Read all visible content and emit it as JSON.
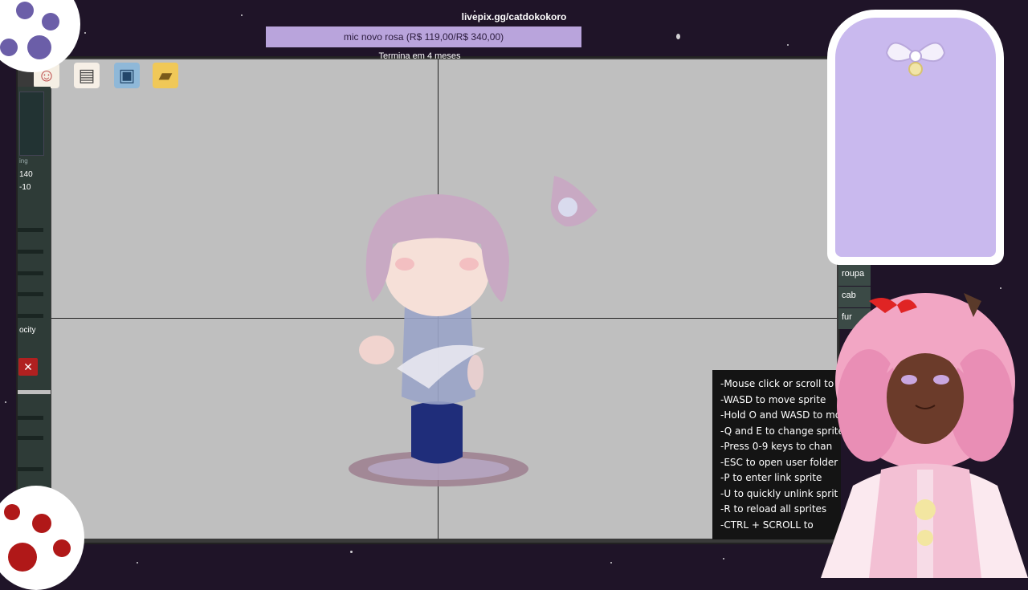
{
  "stream": {
    "donation_link": "livepix.gg/catdokokoro",
    "goal_text": "mic novo rosa (R$ 119,00/R$ 340,00)",
    "goal_subtext": "Termina em 4 meses"
  },
  "toolbar": {
    "icons": [
      "masks-icon",
      "page-icon",
      "save-icon",
      "folder-icon"
    ]
  },
  "left_panel": {
    "partial_label": "ing",
    "value_1": "140",
    "value_2": "-10",
    "opacity_label": "ocity"
  },
  "right_tabs": [
    "roupa",
    "cab",
    "fur"
  ],
  "instructions": [
    "-Mouse click or scroll to",
    "-WASD to move sprite",
    "-Hold O and WASD to mov",
    "-Q and E to change sprite l",
    "-Press 0-9 keys to chan",
    "-ESC to open user folder",
    "-P to enter link sprite",
    "-U to quickly unlink sprit",
    "-R to reload all sprites",
    "-CTRL + SCROLL to"
  ],
  "colors": {
    "background": "#1f1428",
    "canvas": "#bfbfbf",
    "banner": "#b9a4dc",
    "card": "#c9b9ee"
  }
}
